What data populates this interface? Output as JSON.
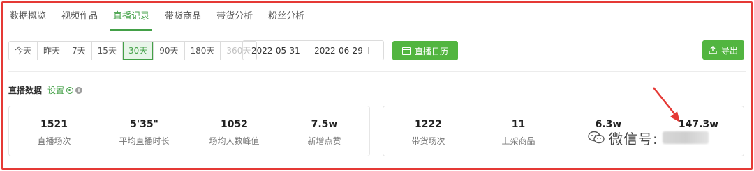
{
  "tabs": [
    {
      "label": "数据概览",
      "active": false
    },
    {
      "label": "视频作品",
      "active": false
    },
    {
      "label": "直播记录",
      "active": true
    },
    {
      "label": "带货商品",
      "active": false
    },
    {
      "label": "带货分析",
      "active": false
    },
    {
      "label": "粉丝分析",
      "active": false
    }
  ],
  "ranges": [
    {
      "label": "今天",
      "state": "normal"
    },
    {
      "label": "昨天",
      "state": "normal"
    },
    {
      "label": "7天",
      "state": "normal"
    },
    {
      "label": "15天",
      "state": "normal"
    },
    {
      "label": "30天",
      "state": "active"
    },
    {
      "label": "90天",
      "state": "normal"
    },
    {
      "label": "180天",
      "state": "normal"
    },
    {
      "label": "360天",
      "state": "disabled"
    }
  ],
  "date_range": {
    "start": "2022-05-31",
    "separator": "-",
    "end": "2022-06-29"
  },
  "buttons": {
    "live_calendar": "直播日历",
    "export": "导出"
  },
  "section": {
    "title": "直播数据",
    "settings": "设置",
    "info_glyph": "i"
  },
  "metrics_left": [
    {
      "value": "1521",
      "label": "直播场次"
    },
    {
      "value": "5'35\"",
      "label": "平均直播时长"
    },
    {
      "value": "1052",
      "label": "场均人数峰值"
    },
    {
      "value": "7.5w",
      "label": "新增点赞"
    }
  ],
  "metrics_right": [
    {
      "value": "1222",
      "label": "带货场次"
    },
    {
      "value": "11",
      "label": "上架商品"
    },
    {
      "value": "6.3w",
      "label": ""
    },
    {
      "value": "147.3w",
      "label": ""
    }
  ],
  "watermark": {
    "text": "微信号:"
  },
  "colors": {
    "accent": "#43a047",
    "button": "#52b540",
    "frame": "#e53935",
    "arrow": "#e53935"
  }
}
